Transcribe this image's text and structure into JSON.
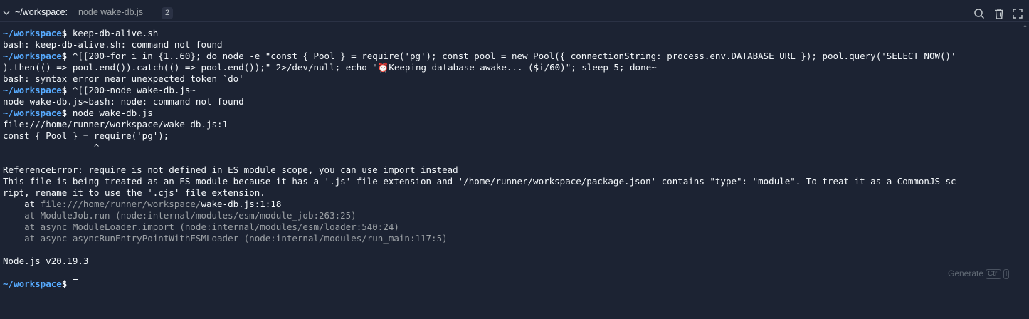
{
  "tab": {
    "path": "~/workspace:",
    "command": "node wake-db.js",
    "badge": "2"
  },
  "icons": {
    "collapse": "chevron-down-icon",
    "search": "search-icon",
    "trash": "trash-icon",
    "maximize": "maximize-icon"
  },
  "terminal": {
    "prompt": "~/workspace",
    "prompt_symbol": "$",
    "lines": [
      " keep-db-alive.sh",
      "bash: keep-db-alive.sh: command not found",
      " ^[[200~for i in {1..60}; do node -e \"const { Pool } = require('pg'); const pool = new Pool({ connectionString: process.env.DATABASE_URL }); pool.query('SELECT NOW()'",
      ").then(() => pool.end()).catch(() => pool.end());\" 2>/dev/null; echo \"⏰Keeping database awake... ($i/60)\"; sleep 5; done~",
      "bash: syntax error near unexpected token `do'",
      " ^[[200~node wake-db.js~",
      "node wake-db.js~bash: node: command not found",
      " node wake-db.js",
      "file:///home/runner/workspace/wake-db.js:1",
      "const { Pool } = require('pg');",
      "                 ^",
      "",
      "ReferenceError: require is not defined in ES module scope, you can use import instead",
      "This file is being treated as an ES module because it has a '.js' file extension and '/home/runner/workspace/package.json' contains \"type\": \"module\". To treat it as a CommonJS sc",
      "ript, rename it to use the '.cjs' file extension.",
      "    at ",
      "file:///home/runner/workspace/",
      "wake-db.js:1:18",
      "    at ModuleJob.run (node:internal/modules/esm/module_job:263:25)",
      "    at async ModuleLoader.import (node:internal/modules/esm/loader:540:24)",
      "    at async asyncRunEntryPointWithESMLoader (node:internal/modules/run_main:117:5)",
      "",
      "Node.js v20.19.3"
    ]
  },
  "generate": {
    "label": "Generate",
    "key1": "Ctrl",
    "key2": "I"
  },
  "colors": {
    "background": "#1c2333",
    "prompt": "#57abff",
    "text": "#f5f9fc",
    "muted": "#9da2a6"
  }
}
